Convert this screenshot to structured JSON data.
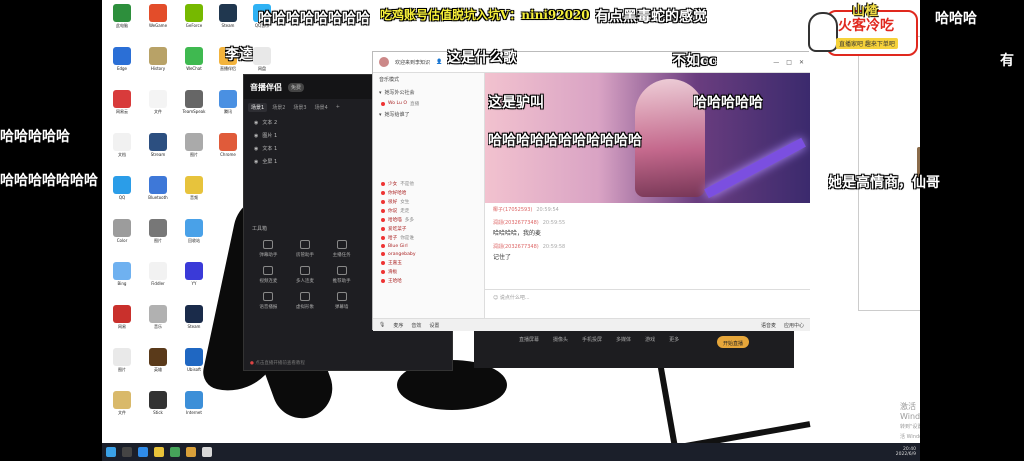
{
  "danmaku": [
    {
      "text": "哈哈哈哈哈哈哈哈",
      "color": "white"
    },
    {
      "text": "吃鸡账号估值脱坑入坑V：nini92020",
      "color": "yellow"
    },
    {
      "text": "有点黑毒蛇的感觉",
      "color": "white"
    },
    {
      "text": "哈哈哈",
      "color": "white"
    },
    {
      "text": "李逵",
      "color": "white"
    },
    {
      "text": "这是什么歌",
      "color": "white"
    },
    {
      "text": "不如cc",
      "color": "white"
    },
    {
      "text": "有",
      "color": "white"
    },
    {
      "text": "哈哈哈哈哈",
      "color": "white"
    },
    {
      "text": "这是驴叫",
      "color": "white"
    },
    {
      "text": "哈哈哈哈哈",
      "color": "white"
    },
    {
      "text": "哈哈哈哈哈哈哈哈哈哈哈",
      "color": "white"
    },
    {
      "text": "哈哈哈哈哈哈哈",
      "color": "white"
    },
    {
      "text": "她是高情商，仙哥",
      "color": "white"
    }
  ],
  "badge": {
    "title": "火客冷吃",
    "subtitle": "直播家吧 趣来下单吧",
    "name": "山楂"
  },
  "stream_window": {
    "logo": "音播伴侣",
    "logo_tag": "免费",
    "scene_tabs": [
      "场景1",
      "场景2",
      "场景3",
      "场景4",
      "+"
    ],
    "sources": [
      "文本 2",
      "图片 1",
      "文本 1",
      "全屏 1"
    ],
    "tools_title": "工具箱",
    "tools": [
      "弹幕助手",
      "房管助手",
      "主播任务",
      "视频连麦",
      "多人连麦",
      "推荐助手",
      "语音播报",
      "虚拟形象",
      "弹幕墙"
    ],
    "footer": "点击直播开播前查看教程"
  },
  "yy_window": {
    "header_text": "欢迎来到李知识",
    "count": "252",
    "sections": [
      "音乐模式",
      "她写外公社会",
      "她写给谁了"
    ],
    "members": [
      {
        "name": "Wo Lu O",
        "extra": "直播"
      },
      {
        "name": "少女",
        "extra": "不是他"
      },
      {
        "name": "你好哈哈",
        "extra": ""
      },
      {
        "name": "很好",
        "extra": "女生"
      },
      {
        "name": "你说",
        "extra": "走走"
      },
      {
        "name": "哈哈喵",
        "extra": "多多"
      },
      {
        "name": "爱吃菜子",
        "extra": ""
      },
      {
        "name": "哈子",
        "extra": "你是谁"
      },
      {
        "name": "Blue Girl",
        "extra": ""
      },
      {
        "name": "orangebaby",
        "extra": ""
      },
      {
        "name": "王嘉玉",
        "extra": ""
      },
      {
        "name": "滑板",
        "extra": ""
      },
      {
        "name": "王哈哈",
        "extra": ""
      }
    ],
    "messages": [
      {
        "who": "椰子(17052593)",
        "time": "20:59:54",
        "text": ""
      },
      {
        "who": "润翃(2032677348)",
        "time": "20:59:55",
        "text": "哈哈哈哈，我的麦"
      },
      {
        "who": "润翃(2032677348)",
        "time": "20:59:58",
        "text": "记住了"
      }
    ],
    "input_placeholder": "说点什么吧...",
    "bottom_bar": [
      "麦序",
      "音效",
      "设置"
    ],
    "bottom_right": [
      "语音麦",
      "应用中心"
    ]
  },
  "control_strip": [
    "直播屏幕",
    "摄像头",
    "手机投屏",
    "多媒体",
    "游戏",
    "更多"
  ],
  "live_button": "开始直播",
  "watermark": {
    "line1": "激活 Windows",
    "line2": "转到\"设置\"以激活 Windows。"
  },
  "clock": {
    "time": "20:40",
    "date": "2022/6/9"
  },
  "desktop_icons": [
    "此电脑",
    "Edge",
    "网易云",
    "文档",
    "QQ",
    "Color",
    "Bing",
    "网易",
    "图片",
    "文件",
    "WeGame",
    "History",
    "文件",
    "Stream",
    "Bluetooth",
    "图片",
    "Fiddler",
    "音乐",
    "英雄",
    "Stick",
    "GeForce",
    "WeChat",
    "TeamSpeak",
    "图片",
    "音频",
    "回收站",
    "YY",
    "Steam",
    "Ubisoft",
    "Internet",
    "Steam",
    "直播伴侣",
    "腾讯",
    "Chrome",
    "QQ音乐",
    "网盘",
    "音乐"
  ]
}
